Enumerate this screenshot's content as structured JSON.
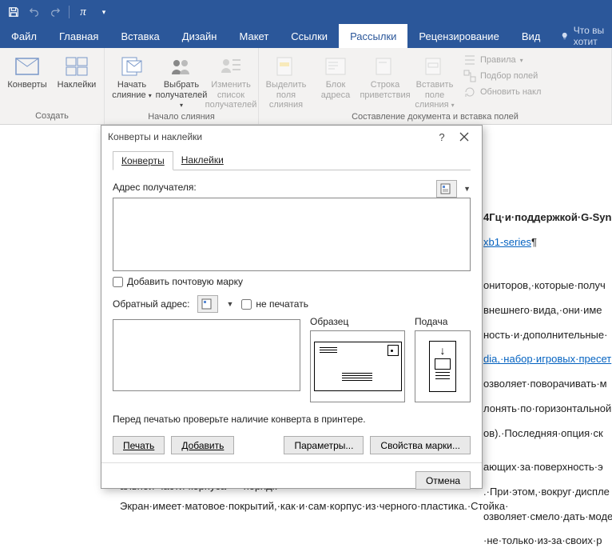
{
  "qat": {
    "arrow": "▾"
  },
  "tabs": {
    "file": "Файл",
    "home": "Главная",
    "insert": "Вставка",
    "design": "Дизайн",
    "layout": "Макет",
    "references": "Ссылки",
    "mailings": "Рассылки",
    "review": "Рецензирование",
    "view": "Вид",
    "tellme": "Что вы хотит"
  },
  "ribbon": {
    "group_create": "Создать",
    "group_start": "Начало слияния",
    "group_compose": "Составление документа и вставка полей",
    "envelopes": "Конверты",
    "labels": "Наклейки",
    "start_merge": "Начать слияние",
    "select_recipients": "Выбрать получателей",
    "edit_recipients": "Изменить список получателей",
    "highlight_fields": "Выделить поля слияния",
    "address_block": "Блок адреса",
    "greeting_line": "Строка приветствия",
    "insert_field": "Вставить поле слияния",
    "rules": "Правила",
    "match_fields": "Подбор полей",
    "update_labels": "Обновить накл"
  },
  "dialog": {
    "title": "Конверты и наклейки",
    "tab_envelopes": "Конверты",
    "tab_labels": "Наклейки",
    "recipient_addr": "Адрес получателя:",
    "add_postage": "Добавить почтовую марку",
    "return_addr": "Обратный адрес:",
    "no_print": "не печатать",
    "sample": "Образец",
    "feed": "Подача",
    "hint": "Перед печатью проверьте наличие конверта в принтере.",
    "print": "Печать",
    "add": "Добавить",
    "params": "Параметры...",
    "stamp_props": "Свойства марки...",
    "cancel": "Отмена"
  },
  "doc": {
    "h1": "4Гц·и·поддержкой·G-Syn",
    "link": "xb1-series",
    "p1": "ониторов,·которые·получ",
    "p2": "внешнего·вида,·они·име",
    "p3": "ность·и·дополнительные·",
    "p4": "dia,·набор·игровых·пресет",
    "p5": "озволяет·поворачивать·м",
    "p6": "лонять·по·горизонтальной",
    "p7": "ов).·Последняя·опция·ск",
    "p8": "ающих·за·поверхность·э",
    "p9": ".·При·этом,·вокруг·диспле",
    "p10": "озволяет·смело·дать·моде",
    "p11": "·не·только·из-за·своих·р",
    "p12": "альной·части·корпуса·—·порядк",
    "p13": "Экран·имеет·матовое·покрытий,·как·и·сам·корпус·из·черного·пластика.·Стойка·"
  }
}
